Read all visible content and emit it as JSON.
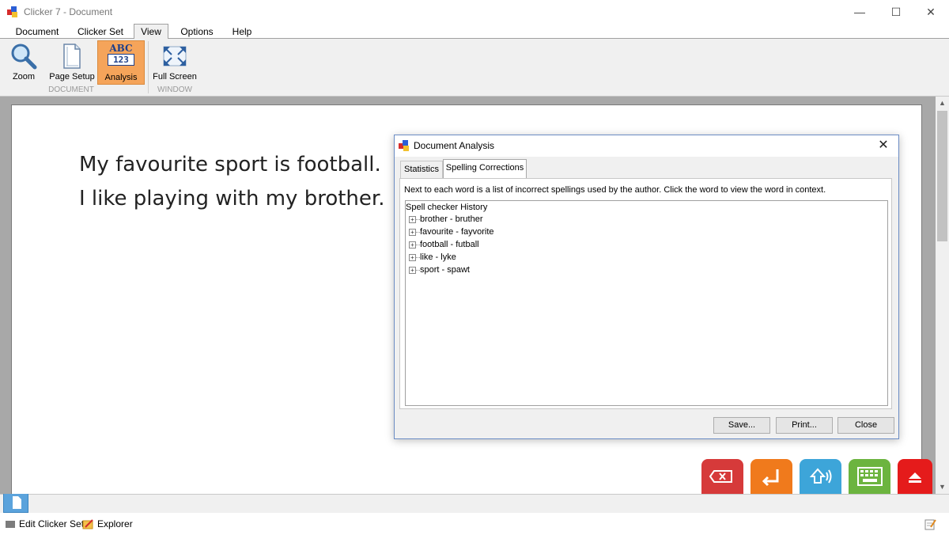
{
  "window": {
    "title": "Clicker 7 - Document",
    "minimize": "—",
    "maximize": "☐",
    "close": "✕"
  },
  "menu": {
    "tabs": [
      "Document",
      "Clicker Set",
      "View",
      "Options",
      "Help"
    ],
    "active": "View"
  },
  "ribbon": {
    "buttons": [
      {
        "label": "Zoom",
        "icon": "magnifier-icon"
      },
      {
        "label": "Page Setup",
        "icon": "page-icon"
      },
      {
        "label": "Analysis",
        "icon": "abc-123-icon",
        "icon_text_top": "ABC",
        "icon_text_bottom": "123",
        "active": true
      },
      {
        "label": "Full Screen",
        "icon": "expand-arrows-icon"
      }
    ],
    "groups": [
      "DOCUMENT",
      "WINDOW"
    ]
  },
  "document": {
    "lines": [
      "My favourite sport is football.",
      "I like playing with my brother."
    ]
  },
  "dialog": {
    "title": "Document Analysis",
    "close": "✕",
    "tabs": [
      "Statistics",
      "Spelling Corrections"
    ],
    "active_tab": "Spelling Corrections",
    "description": "Next to each word is a list of incorrect spellings used by the author. Click the word to view the word in context.",
    "tree_root": "Spell checker History",
    "tree_items": [
      "brother - bruther",
      "favourite - fayvorite",
      "football - futball",
      "like - lyke",
      "sport - spawt"
    ],
    "buttons": {
      "save": "Save...",
      "print": "Print...",
      "close": "Close"
    }
  },
  "action_buttons": [
    {
      "name": "delete",
      "icon": "backspace-icon",
      "color": "#d63a3a"
    },
    {
      "name": "enter",
      "icon": "enter-icon",
      "color": "#f07a1c"
    },
    {
      "name": "speak",
      "icon": "speak-icon",
      "color": "#3da5d9"
    },
    {
      "name": "keyboard",
      "icon": "keyboard-icon",
      "color": "#6cb43f"
    },
    {
      "name": "eject",
      "icon": "eject-icon",
      "color": "#e51b1b"
    }
  ],
  "statusbar": {
    "edit": "Edit Clicker Set",
    "explorer": "Explorer"
  },
  "scroll": {
    "up": "▲",
    "down": "▼"
  }
}
